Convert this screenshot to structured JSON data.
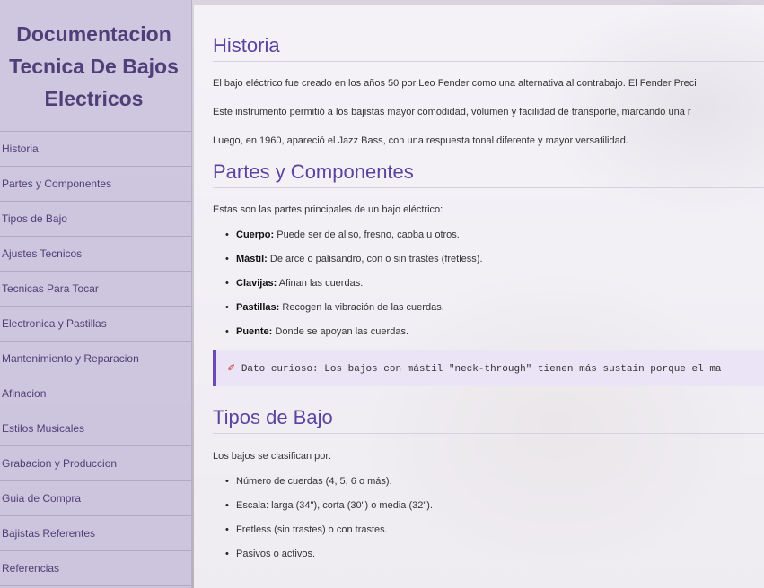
{
  "sidebar": {
    "title_lines": [
      "Documentacion",
      "Tecnica De Bajos",
      "Electricos"
    ],
    "items": [
      {
        "label": "Historia"
      },
      {
        "label": "Partes y Componentes"
      },
      {
        "label": "Tipos de Bajo"
      },
      {
        "label": "Ajustes Tecnicos"
      },
      {
        "label": "Tecnicas Para Tocar"
      },
      {
        "label": "Electronica y Pastillas"
      },
      {
        "label": "Mantenimiento y Reparacion"
      },
      {
        "label": "Afinacion"
      },
      {
        "label": "Estilos Musicales"
      },
      {
        "label": "Grabacion y Produccion"
      },
      {
        "label": "Guia de Compra"
      },
      {
        "label": "Bajistas Referentes"
      },
      {
        "label": "Referencias"
      }
    ]
  },
  "historia": {
    "heading": "Historia",
    "p1": "El bajo eléctrico fue creado en los años 50 por Leo Fender como una alternativa al contrabajo. El Fender Preci",
    "p2": "Este instrumento permitió a los bajistas mayor comodidad, volumen y facilidad de transporte, marcando una r",
    "p3": "Luego, en 1960, apareció el Jazz Bass, con una respuesta tonal diferente y mayor versatilidad."
  },
  "partes": {
    "heading": "Partes y Componentes",
    "intro": "Estas son las partes principales de un bajo eléctrico:",
    "items": [
      {
        "term": "Cuerpo:",
        "desc": " Puede ser de aliso, fresno, caoba u otros."
      },
      {
        "term": "Mástil:",
        "desc": " De arce o palisandro, con o sin trastes (fretless)."
      },
      {
        "term": "Clavijas:",
        "desc": " Afinan las cuerdas."
      },
      {
        "term": "Pastillas:",
        "desc": " Recogen la vibración de las cuerdas."
      },
      {
        "term": "Puente:",
        "desc": " Donde se apoyan las cuerdas."
      }
    ],
    "tip_icon": "pencil-icon",
    "tip_text": "Dato curioso: Los bajos con mástil \"neck-through\" tienen más sustain porque el ma"
  },
  "tipos": {
    "heading": "Tipos de Bajo",
    "intro": "Los bajos se clasifican por:",
    "items": [
      "Número de cuerdas (4, 5, 6 o más).",
      "Escala: larga (34\"), corta (30\") o media (32\").",
      "Fretless (sin trastes) o con trastes.",
      "Pasivos o activos."
    ]
  },
  "colors": {
    "accent": "#5a44a0",
    "sidebar_bg": "#cec6e0",
    "tip_border": "#6c4bb3"
  }
}
